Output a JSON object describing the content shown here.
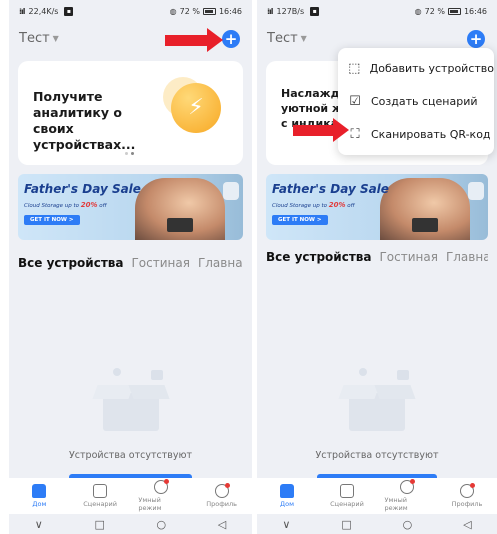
{
  "left": {
    "status": {
      "speed": "22,4K/s",
      "battery": "72 %",
      "time": "16:46"
    },
    "home_name": "Тест",
    "add_symbol": "+",
    "promo_card": {
      "text": "Получите аналитику о своих устройствах..."
    },
    "banner": {
      "title": "Father's Day Sale",
      "subtitle_pre": "Cloud Storage up to",
      "subtitle_pct": "20%",
      "subtitle_post": "off",
      "button": "GET IT NOW >"
    },
    "tabs": [
      "Все устройства",
      "Гостиная",
      "Главная"
    ],
    "more": "•••",
    "empty_text": "Устройства отсутствуют",
    "nav": [
      "Дом",
      "Сценарий",
      "Умный режим",
      "Профиль"
    ]
  },
  "right": {
    "status": {
      "speed": "127B/s",
      "battery": "72 %",
      "time": "16:46"
    },
    "home_name": "Тест",
    "add_symbol": "+",
    "promo_card": {
      "text": "Наслаждайт уютной жиз с индикатор"
    },
    "menu": [
      "Добавить устройство",
      "Создать сценарий",
      "Сканировать QR-код"
    ],
    "banner": {
      "title": "Father's Day Sale",
      "subtitle_pre": "Cloud Storage up to",
      "subtitle_pct": "20%",
      "subtitle_post": "off",
      "button": "GET IT NOW >"
    },
    "tabs": [
      "Все устройства",
      "Гостиная",
      "Главная"
    ],
    "more": "•••",
    "empty_text": "Устройства отсутствуют",
    "nav": [
      "Дом",
      "Сценарий",
      "Умный режим",
      "Профиль"
    ]
  },
  "sysnav": [
    "∨",
    "□",
    "○",
    "◁"
  ],
  "colors": {
    "accent": "#2d7cf6",
    "arrow": "#e8202a",
    "badge": "#e53935"
  }
}
